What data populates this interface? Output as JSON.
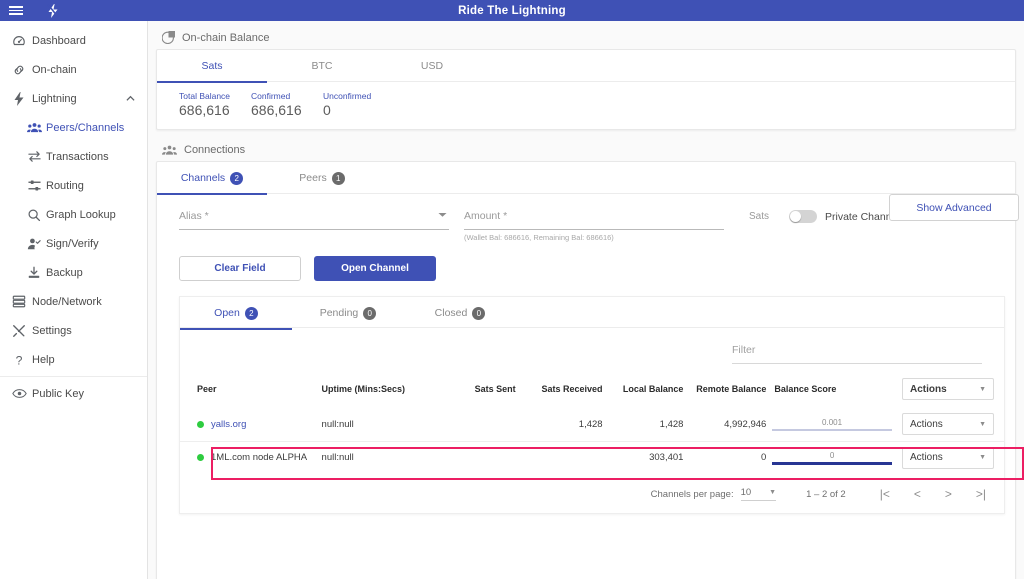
{
  "app": {
    "title": "Ride The Lightning",
    "menu_icon": "hamburger-menu-icon",
    "bolt_icon": "lightning-bolt-icon"
  },
  "sidebar": {
    "items": [
      {
        "label": "Dashboard",
        "icon": "dashboard-icon",
        "active": false,
        "sub": false
      },
      {
        "label": "On-chain",
        "icon": "link-chain-icon",
        "active": false,
        "sub": false
      },
      {
        "label": "Lightning",
        "icon": "bolt-icon",
        "active": false,
        "sub": false,
        "expandable": true
      },
      {
        "label": "Peers/Channels",
        "icon": "people-group-icon",
        "active": true,
        "sub": true
      },
      {
        "label": "Transactions",
        "icon": "transfer-icon",
        "active": false,
        "sub": true
      },
      {
        "label": "Routing",
        "icon": "routing-icon",
        "active": false,
        "sub": true
      },
      {
        "label": "Graph Lookup",
        "icon": "search-icon",
        "active": false,
        "sub": true
      },
      {
        "label": "Sign/Verify",
        "icon": "person-check-icon",
        "active": false,
        "sub": true
      },
      {
        "label": "Backup",
        "icon": "download-icon",
        "active": false,
        "sub": true
      },
      {
        "label": "Node/Network",
        "icon": "server-icon",
        "active": false,
        "sub": false
      },
      {
        "label": "Settings",
        "icon": "tools-icon",
        "active": false,
        "sub": false
      },
      {
        "label": "Help",
        "icon": "question-icon",
        "active": false,
        "sub": false
      },
      {
        "label": "Public Key",
        "icon": "eye-icon",
        "active": false,
        "sub": false
      }
    ]
  },
  "onchain_balance": {
    "section_title": "On-chain Balance",
    "section_icon": "pie-chart-icon",
    "tabs": [
      {
        "label": "Sats",
        "active": true
      },
      {
        "label": "BTC",
        "active": false
      },
      {
        "label": "USD",
        "active": false
      }
    ],
    "stats": [
      {
        "key": "Total Balance",
        "value": "686,616"
      },
      {
        "key": "Confirmed",
        "value": "686,616"
      },
      {
        "key": "Unconfirmed",
        "value": "0"
      }
    ]
  },
  "connections": {
    "section_title": "Connections",
    "section_icon": "people-group-icon",
    "tabs": [
      {
        "label": "Channels",
        "badge": "2",
        "active": true
      },
      {
        "label": "Peers",
        "badge": "1",
        "active": false
      }
    ],
    "form": {
      "alias_label": "Alias *",
      "alias_value": "",
      "amount_label": "Amount *",
      "amount_value": "",
      "amount_units": "Sats",
      "amount_hint": "(Wallet Bal: 686616, Remaining Bal: 686616)",
      "private_channel_label": "Private Channel",
      "private_channel_on": false,
      "show_advanced_label": "Show Advanced",
      "clear_field_label": "Clear Field",
      "open_channel_label": "Open Channel"
    },
    "channel_tabs": [
      {
        "label": "Open",
        "badge": "2",
        "active": true
      },
      {
        "label": "Pending",
        "badge": "0",
        "active": false
      },
      {
        "label": "Closed",
        "badge": "0",
        "active": false
      }
    ],
    "filter": {
      "placeholder": "Filter",
      "value": ""
    },
    "table": {
      "columns": [
        "Peer",
        "Uptime (Mins:Secs)",
        "Sats Sent",
        "Sats Received",
        "Local Balance",
        "Remote Balance",
        "Balance Score"
      ],
      "actions_header": "Actions",
      "rows": [
        {
          "status": "online",
          "peer": "yalls.org",
          "peer_is_link": true,
          "uptime": "null:null",
          "sats_sent": "",
          "sats_received": "1,428",
          "local_balance": "1,428",
          "remote_balance": "4,992,946",
          "balance_score": "0.001",
          "score_bar_style": "light",
          "actions_label": "Actions",
          "highlighted": true
        },
        {
          "status": "online",
          "peer": "1ML.com node ALPHA",
          "peer_is_link": false,
          "uptime": "null:null",
          "sats_sent": "",
          "sats_received": "",
          "local_balance": "303,401",
          "remote_balance": "0",
          "balance_score": "0",
          "score_bar_style": "dark",
          "actions_label": "Actions",
          "highlighted": false
        }
      ]
    },
    "paginator": {
      "per_page_label": "Channels per page:",
      "per_page_value": "10",
      "range_label": "1 – 2 of 2",
      "first_icon": "first-page-icon",
      "prev_icon": "previous-page-icon",
      "next_icon": "next-page-icon",
      "last_icon": "last-page-icon"
    }
  },
  "colors": {
    "primary": "#3f51b5",
    "highlight": "#ec1e63",
    "online": "#2ecc40",
    "score_dark": "#283593"
  }
}
